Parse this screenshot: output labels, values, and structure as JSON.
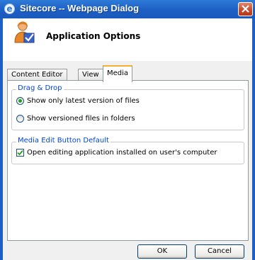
{
  "window": {
    "title": "Sitecore -- Webpage Dialog"
  },
  "header": {
    "title": "Application Options"
  },
  "tabs": [
    {
      "label": "Content Editor",
      "active": false
    },
    {
      "label": "View",
      "active": false
    },
    {
      "label": "Media",
      "active": true
    }
  ],
  "media": {
    "drag_drop": {
      "legend": "Drag & Drop",
      "options": [
        {
          "label": "Show only latest version of files",
          "selected": true
        },
        {
          "label": "Show versioned files in folders",
          "selected": false
        }
      ]
    },
    "edit_button": {
      "legend": "Media Edit Button Default",
      "checkbox_label": "Open editing application installed on user's computer",
      "checked": true
    }
  },
  "buttons": {
    "ok": "OK",
    "cancel": "Cancel"
  },
  "colors": {
    "titlebar": "#1d5fc4",
    "legend_text": "#0046d5",
    "active_tab_accent": "#f3b22d",
    "close": "#c8472a"
  }
}
